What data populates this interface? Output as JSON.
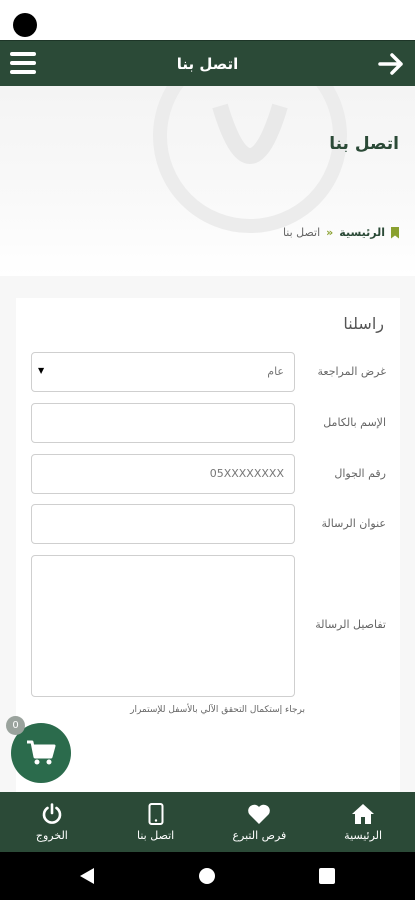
{
  "header": {
    "title": "اتصل بنا"
  },
  "hero": {
    "page_title": "اتصل بنا",
    "breadcrumb": {
      "home": "الرئيسية",
      "separator": "»",
      "current": "اتصل بنا"
    }
  },
  "form": {
    "title": "راسلنا",
    "fields": [
      {
        "label": "غرض المراجعة",
        "value": "عام",
        "type": "select"
      },
      {
        "label": "الإسم بالكامل",
        "value": "",
        "type": "text"
      },
      {
        "label": "رقم الجوال",
        "value": "05XXXXXXXX",
        "type": "text"
      },
      {
        "label": "عنوان الرسالة",
        "value": "",
        "type": "text"
      },
      {
        "label": "تفاصيل الرسالة",
        "value": "",
        "type": "textarea"
      }
    ],
    "note": "برجاء إستكمال التحقق الآلي بالأسفل للإستمرار"
  },
  "cart": {
    "count": "0"
  },
  "bottom_nav": [
    {
      "label": "الرئيسية",
      "icon": "home-icon"
    },
    {
      "label": "فرص التبرع",
      "icon": "heart-icon"
    },
    {
      "label": "اتصل بنا",
      "icon": "phone-icon"
    },
    {
      "label": "الخروج",
      "icon": "power-icon"
    }
  ],
  "colors": {
    "primary": "#2b4a37",
    "accent": "#8aa02f",
    "fab": "#2b6b4c"
  }
}
